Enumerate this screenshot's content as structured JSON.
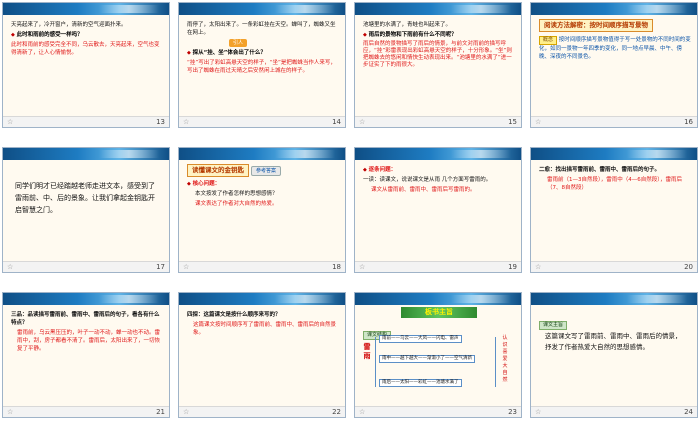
{
  "slides": [
    {
      "number": "13",
      "lines": [
        "天亮起来了，冷开窗户，清新的空气迎面扑来。",
        "此时和雨前的感受一样吗？",
        "此时和雨前的感受完全不同，乌云散去，天亮起来，空气也变得清新了，让人心情愉悦。"
      ]
    },
    {
      "number": "14",
      "lines": [
        "雨停了，太阳出来了。一条彩虹挂在天空。蝉叫了，蜘蛛又坐在网上。",
        "引人",
        "探从“挂、坐”体会出了什么？",
        "“挂”写出了彩虹高悬天空的样子，“坐”是把蜘蛛当作人来写，写出了蜘蛛在雨过天晴之后安然闲上城在的样子。"
      ]
    },
    {
      "number": "15",
      "lines": [
        "池塘里的水满了，青蛙也叫起来了。",
        "雨后的景物和下雨前有什么不同呢？",
        "雨后自然的景物描写了雨后的情景，与前文对雨前的描写呼应，“挂”彩雷表现出彩虹高悬天空的样子，十分形象。“坐”则把蜘蛛去的悠闲和情快生动表现出来。“池塘里的水满了”进一步证实了下的雨很大。"
      ]
    },
    {
      "number": "16",
      "title": "阅读方法解密：按时间顺序描写景物",
      "badge": "概念",
      "text": "按时间顺序描写景物值得于写一处景物的不同时间的变化，如同一景物一年四季的变化，同一地点早晨、中午、傍晚、深夜的不同景色。"
    },
    {
      "number": "17",
      "text": "同学们明才已经踏越老师走进文本，感受到了雷雨前、中、后的景象。让我们拿起金钥匙开启智慧之门。"
    },
    {
      "number": "18",
      "title": "读懂课文的金钥匙",
      "badge": "参考答案",
      "lines": [
        "核心问题：",
        "本文按发了作者怎样的思想感情？",
        "课文表达了作者对大自然的热爱。"
      ]
    },
    {
      "number": "19",
      "lines": [
        "逐条问题：",
        "一读：读课文，说说课文是从雨 几个方面写雷雨的。",
        "课文从雷雨前、雷雨中、雷雨后写雷雨的。"
      ]
    },
    {
      "number": "20",
      "lines": [
        "二愈：找出描写雷雨前、雷雨中、雷雨后的句子。",
        "雷雨前（1—3自然段），雷雨中（4—6自然段），雷雨后（7、8自然段）"
      ]
    },
    {
      "number": "21",
      "lines": [
        "三品：品读描写雷雨前、雷雨中、雷雨后的句子，看各有什么特点？",
        "雷雨前，乌云黑压压的，叶子一动不动，蝉一动也不动。雷雨中，刮，房子都看不清了。雷雨后，太阳出来了，一切恢复了平静。"
      ]
    },
    {
      "number": "22",
      "lines": [
        "四探：这篇课文是按什么顺序来写的？",
        "这篇课文按时间顺序写了雷雨前、雷雨中、雷雨后的自然景象。"
      ]
    },
    {
      "number": "23",
      "title": "板书主旨",
      "tag": "课文结构",
      "side_left": "雷雨",
      "side_right": "认识喜爱大自然",
      "flows": [
        "雨前——乌云——大风——闪电、雷声",
        "雨中——越下越大——渐渐小了——空气清新",
        "雨后——太阳——彩虹——池塘水满了"
      ]
    },
    {
      "number": "24",
      "tag": "课文主旨",
      "text": "这篇课文写了雷雨前、雷雨中、雷雨后的情景，抒发了作者热爱大自然的思想感情。"
    }
  ],
  "colors": {
    "red": "#e01818",
    "banner": "#1e7cc2",
    "footer": "#f3f3f3"
  }
}
